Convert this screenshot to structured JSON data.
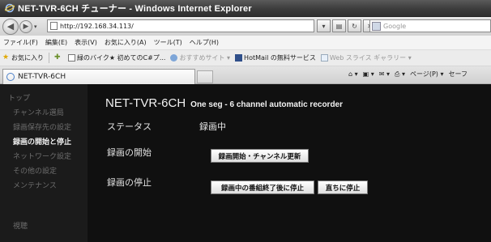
{
  "window": {
    "title": "NET-TVR-6CH チューナー - Windows Internet Explorer"
  },
  "address_bar": {
    "url": "http://192.168.34.113/",
    "search_placeholder": "Google"
  },
  "menu": [
    "ファイル(F)",
    "編集(E)",
    "表示(V)",
    "お気に入り(A)",
    "ツール(T)",
    "ヘルプ(H)"
  ],
  "favorites": {
    "label": "お気に入り",
    "items": [
      "緑のバイク★ 初めてのC#プ...",
      "おすすめサイト ▾",
      "HotMail の無料サービス",
      "Web スライス ギャラリー ▾"
    ]
  },
  "tab": {
    "title": "NET-TVR-6CH"
  },
  "command_bar": {
    "page_label": "ページ(P) ▾",
    "safety_label": "セーフ"
  },
  "sidebar": {
    "items": [
      {
        "label": "トップ",
        "state": "normal"
      },
      {
        "label": "チャンネル選局",
        "state": "normal"
      },
      {
        "label": "録画保存先の設定",
        "state": "normal"
      },
      {
        "label": "録画の開始と停止",
        "state": "active"
      },
      {
        "label": "ネットワーク設定",
        "state": "normal"
      },
      {
        "label": "その他の設定",
        "state": "normal"
      },
      {
        "label": "メンテナンス",
        "state": "normal"
      },
      {
        "label": "視聴",
        "state": "normal"
      }
    ]
  },
  "main": {
    "title": "NET-TVR-6CH",
    "subtitle": "One seg - 6 channel automatic recorder",
    "status_label": "ステータス",
    "status_value": "録画中",
    "start_label": "録画の開始",
    "start_button": "録画開始・チャンネル更新",
    "stop_label": "録画の停止",
    "stop_after_button": "録画中の番組終了後に停止",
    "stop_now_button": "直ちに停止"
  }
}
